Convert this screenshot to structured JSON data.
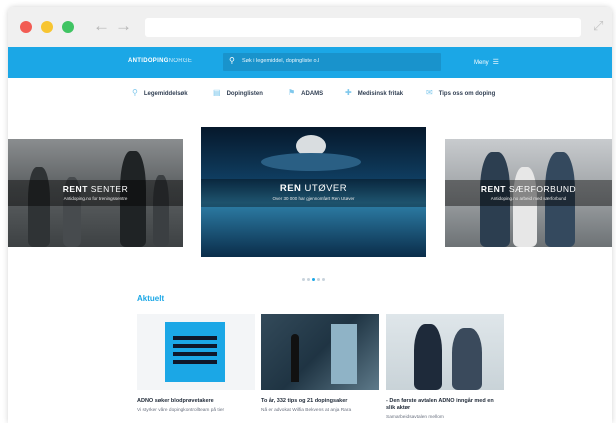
{
  "header": {
    "logo_bold": "ANTIDOPING",
    "logo_light": "NORGE",
    "search_placeholder": "Søk i legemiddel, dopingliste o.l",
    "menu_label": "Meny"
  },
  "subnav": {
    "items": [
      {
        "icon": "pill-icon",
        "glyph": "⚲",
        "label": "Legemiddelsøk"
      },
      {
        "icon": "document-icon",
        "glyph": "▤",
        "label": "Dopinglisten"
      },
      {
        "icon": "location-icon",
        "glyph": "⚑",
        "label": "ADAMS"
      },
      {
        "icon": "medical-icon",
        "glyph": "✚",
        "label": "Medisinsk fritak"
      },
      {
        "icon": "chat-icon",
        "glyph": "✉",
        "label": "Tips oss om doping"
      }
    ]
  },
  "carousel": {
    "slides": [
      {
        "title_bold": "RENT",
        "title_light": "SENTER",
        "subtitle": "Antidoping.no for treningssentre"
      },
      {
        "title_bold": "REN",
        "title_light": "UTØVER",
        "subtitle": "Over 30 000 har gjennomført Ren Utøver"
      },
      {
        "title_bold": "RENT",
        "title_light": "SÆRFORBUND",
        "subtitle": "Antidoping.no arbeid med særforbund"
      }
    ],
    "active_index": 2,
    "page_count": 5
  },
  "news": {
    "section_title": "Aktuelt",
    "cards": [
      {
        "title": "ADNO søker blodprøvetakere",
        "text": "Vi styrker våre dopingkontrollteam på tier"
      },
      {
        "title": "To år, 332 tips og 21 dopingsaker",
        "text": "Nå er advokat Wilfia Bekvens at anja Rara"
      },
      {
        "title": "- Den første avtalen ADNO inngår med en slik aktør",
        "text": "Samarbeidsavtalen mellom"
      }
    ]
  },
  "colors": {
    "brand_blue": "#1ba7e6",
    "search_blue": "#1993cc"
  }
}
